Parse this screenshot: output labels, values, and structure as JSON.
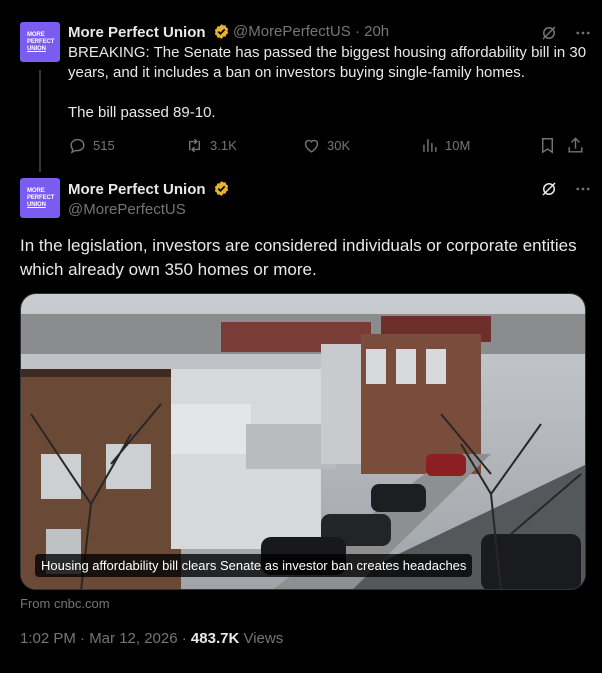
{
  "colors": {
    "accent": "#1d9bf0",
    "verified": "#e8b22a",
    "avatar": "#7b5cf0",
    "muted": "#71767b"
  },
  "avatar_text": [
    "MORE",
    "PERFECT",
    "UNION"
  ],
  "tweet1": {
    "name": "More Perfect Union",
    "handle": "@MorePerfectUS",
    "sep": "·",
    "time": "20h",
    "paragraph1": "BREAKING: The Senate has passed the biggest housing affordability bill in 30 years, and it includes a ban on investors buying single-family homes.",
    "paragraph2": "The bill passed 89-10.",
    "actions": {
      "replies": "515",
      "reposts": "3.1K",
      "likes": "30K",
      "views": "10M"
    }
  },
  "tweet2": {
    "name": "More Perfect Union",
    "handle": "@MorePerfectUS",
    "text": "In the legislation, investors are considered individuals or corporate entities which already own 350 homes or more.",
    "media_caption": "Housing affordability bill clears Senate as investor ban creates headaches",
    "source": "From cnbc.com",
    "timestamp": "1:02 PM · Mar 12, 2026 · ",
    "views_count": "483.7K",
    "views_label": " Views"
  }
}
